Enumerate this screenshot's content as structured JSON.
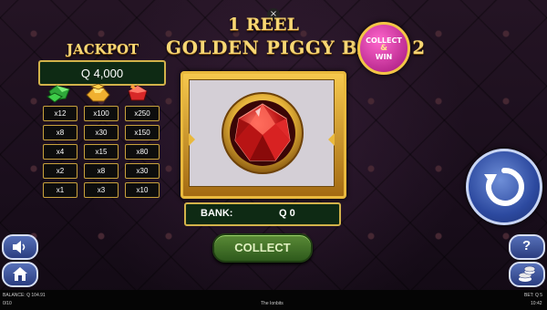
{
  "header": {
    "close_glyph": "×",
    "title_line1": "1 REEL",
    "title_line2": "GOLDEN PIGGY BANK 2",
    "badge": [
      "COLLECT",
      "&",
      "WIN"
    ]
  },
  "jackpot": {
    "label": "JACKPOT",
    "amount": "Q 4,000"
  },
  "paytable": {
    "columns": [
      {
        "gem": "green-gem-icon",
        "color": "#3fcf4a",
        "values": [
          "x12",
          "x8",
          "x4",
          "x2",
          "x1"
        ]
      },
      {
        "gem": "gold-gem-icon",
        "color": "#f0b030",
        "values": [
          "x100",
          "x30",
          "x15",
          "x8",
          "x3"
        ]
      },
      {
        "gem": "red-gem-icon",
        "color": "#e03030",
        "values": [
          "x250",
          "x150",
          "x80",
          "x30",
          "x10"
        ]
      }
    ]
  },
  "reel": {
    "symbol": "red-diamond-icon"
  },
  "bank": {
    "label": "BANK:",
    "value": "Q 0"
  },
  "collect_button": "COLLECT",
  "side_buttons": {
    "sound": "speaker-icon",
    "home": "home-icon",
    "help": "?",
    "coins": "coins-icon"
  },
  "status_bar": {
    "balance": "BALANCE: Q 104.91",
    "bet": "BET: Q 5",
    "left_small": "0/10",
    "center": "The Ionbits",
    "time": "10:42"
  },
  "colors": {
    "gold": "#f7d774",
    "panel_green": "#0e2a14",
    "spin_blue": "#2d4aa0"
  }
}
